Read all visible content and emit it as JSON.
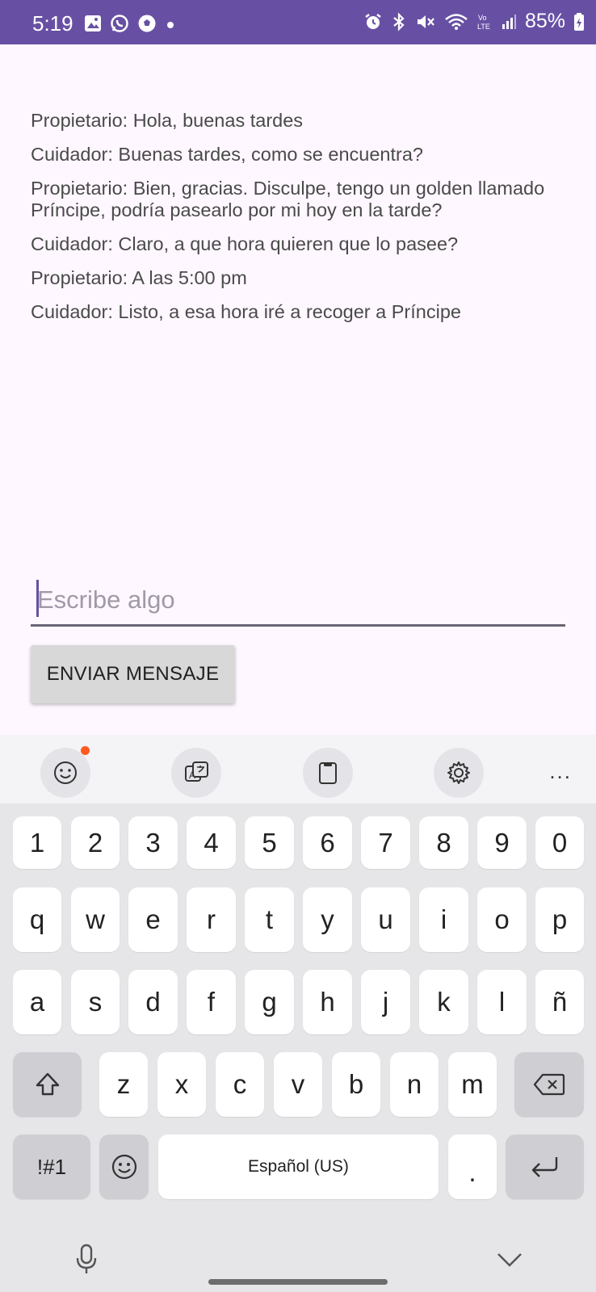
{
  "status_bar": {
    "time": "5:19",
    "battery": "85%",
    "left_icons": [
      "image-icon",
      "whatsapp-icon",
      "soccer-ball-icon",
      "dot-icon"
    ],
    "right_icons": [
      "alarm-icon",
      "bluetooth-icon",
      "mute-icon",
      "wifi-icon",
      "volte-icon",
      "signal-icon",
      "battery-icon"
    ],
    "bar_color": "#6750a4"
  },
  "conversation": [
    "Propietario: Hola, buenas tardes",
    "Cuidador: Buenas tardes, como se encuentra?",
    "Propietario: Bien, gracias. Disculpe, tengo un golden llamado Príncipe, podría pasearlo por mi hoy en la tarde?",
    "Cuidador: Claro, a que hora quieren que lo pasee?",
    "Propietario: A las 5:00 pm",
    "Cuidador: Listo, a esa hora iré a recoger a Príncipe"
  ],
  "input": {
    "value": "",
    "placeholder": "Escribe algo"
  },
  "send_button": {
    "label": "ENVIAR MENSAJE"
  },
  "keyboard": {
    "toolbar_icons": [
      "emoji-icon",
      "translate-icon",
      "clipboard-icon",
      "settings-icon",
      "more-icon"
    ],
    "more_label": "...",
    "row_numbers": [
      "1",
      "2",
      "3",
      "4",
      "5",
      "6",
      "7",
      "8",
      "9",
      "0"
    ],
    "row_1": [
      "q",
      "w",
      "e",
      "r",
      "t",
      "y",
      "u",
      "i",
      "o",
      "p"
    ],
    "row_2": [
      "a",
      "s",
      "d",
      "f",
      "g",
      "h",
      "j",
      "k",
      "l",
      "ñ"
    ],
    "row_3": [
      "z",
      "x",
      "c",
      "v",
      "b",
      "n",
      "m"
    ],
    "symbols_label": "!#1",
    "space_label": "Español (US)",
    "period_label": "."
  }
}
